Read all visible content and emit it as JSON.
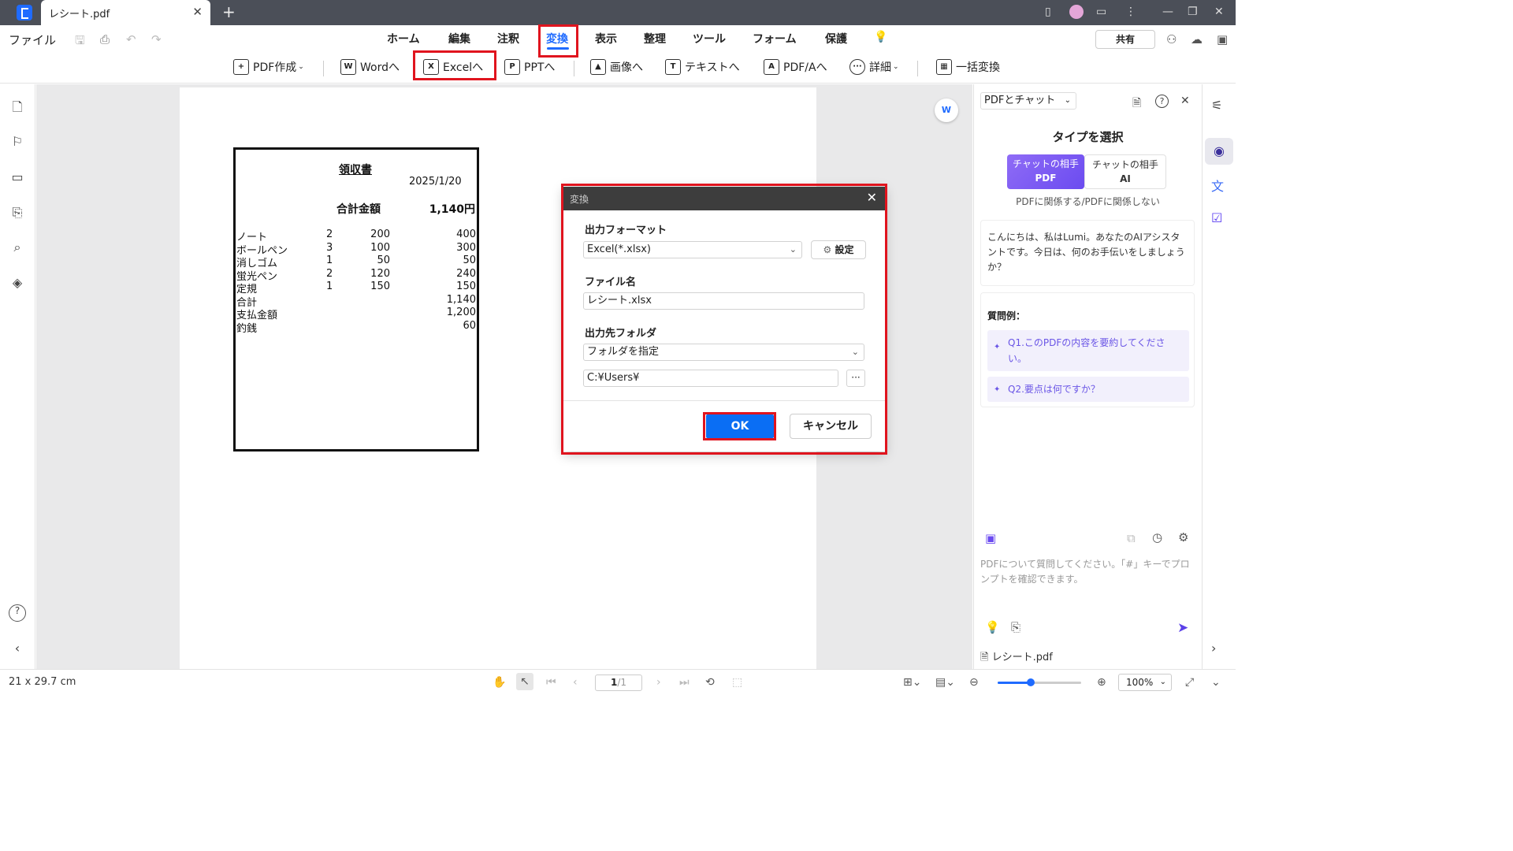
{
  "titlebar": {
    "tab_label": "レシート.pdf",
    "close_glyph": "✕",
    "new_tab_glyph": "+"
  },
  "menubar": {
    "file": "ファイル",
    "items": [
      "ホーム",
      "編集",
      "注釈",
      "変換",
      "表示",
      "整理",
      "ツール",
      "フォーム",
      "保護"
    ],
    "active": "変換",
    "share": "共有"
  },
  "toolbar": {
    "create_pdf": "PDF作成",
    "word": "Wordへ",
    "excel": "Excelへ",
    "ppt": "PPTへ",
    "image": "画像へ",
    "text": "テキストへ",
    "pdfa": "PDF/Aへ",
    "details": "詳細",
    "batch": "一括変換"
  },
  "receipt": {
    "title": "領収書",
    "date": "2025/1/20",
    "total_label": "合計金額",
    "total_value": "1,140円",
    "rows": [
      {
        "name": "ノート",
        "qty": "2",
        "price": "200",
        "amount": "400"
      },
      {
        "name": "ボールペン",
        "qty": "3",
        "price": "100",
        "amount": "300"
      },
      {
        "name": "消しゴム",
        "qty": "1",
        "price": "50",
        "amount": "50"
      },
      {
        "name": "蛍光ペン",
        "qty": "2",
        "price": "120",
        "amount": "240"
      },
      {
        "name": "定規",
        "qty": "1",
        "price": "150",
        "amount": "150"
      },
      {
        "name": "合計",
        "qty": "",
        "price": "",
        "amount": "1,140"
      },
      {
        "name": "支払金額",
        "qty": "",
        "price": "",
        "amount": "1,200"
      },
      {
        "name": "釣銭",
        "qty": "",
        "price": "",
        "amount": "60"
      }
    ]
  },
  "dialog": {
    "title": "変換",
    "format_label": "出力フォーマット",
    "format_value": "Excel(*.xlsx)",
    "settings": "設定",
    "filename_label": "ファイル名",
    "filename_value": "レシート.xlsx",
    "folder_label": "出力先フォルダ",
    "folder_mode": "フォルダを指定",
    "folder_path": "C:¥Users¥",
    "ok": "OK",
    "cancel": "キャンセル"
  },
  "right_panel": {
    "mode_select": "PDFとチャット",
    "type_title": "タイプを選択",
    "type_pdf_line1": "チャットの相手",
    "type_pdf_line2": "PDF",
    "type_ai_line1": "チャットの相手",
    "type_ai_line2": "AI",
    "type_caption": "PDFに関係する/PDFに関係しない",
    "greeting": "こんにちは、私はLumi。あなたのAIアシスタントです。今日は、何のお手伝いをしましょうか？",
    "examples_title": "質問例：",
    "examples": [
      "Q1.このPDFの内容を要約してください。",
      "Q2.要点は何ですか？"
    ],
    "input_placeholder": "PDFについて質問してください。「#」キーでプロンプトを確認できます。",
    "file_name": "レシート.pdf"
  },
  "statusbar": {
    "page_size": "21 x 29.7 cm",
    "page_current": "1",
    "page_total": "/1",
    "zoom": "100%",
    "zoom_level": 0.4
  },
  "colors": {
    "accent": "#1f6bff",
    "highlight": "#e0141e",
    "ai_purple": "#6b4bf0",
    "titlebar": "#4b4f58"
  }
}
